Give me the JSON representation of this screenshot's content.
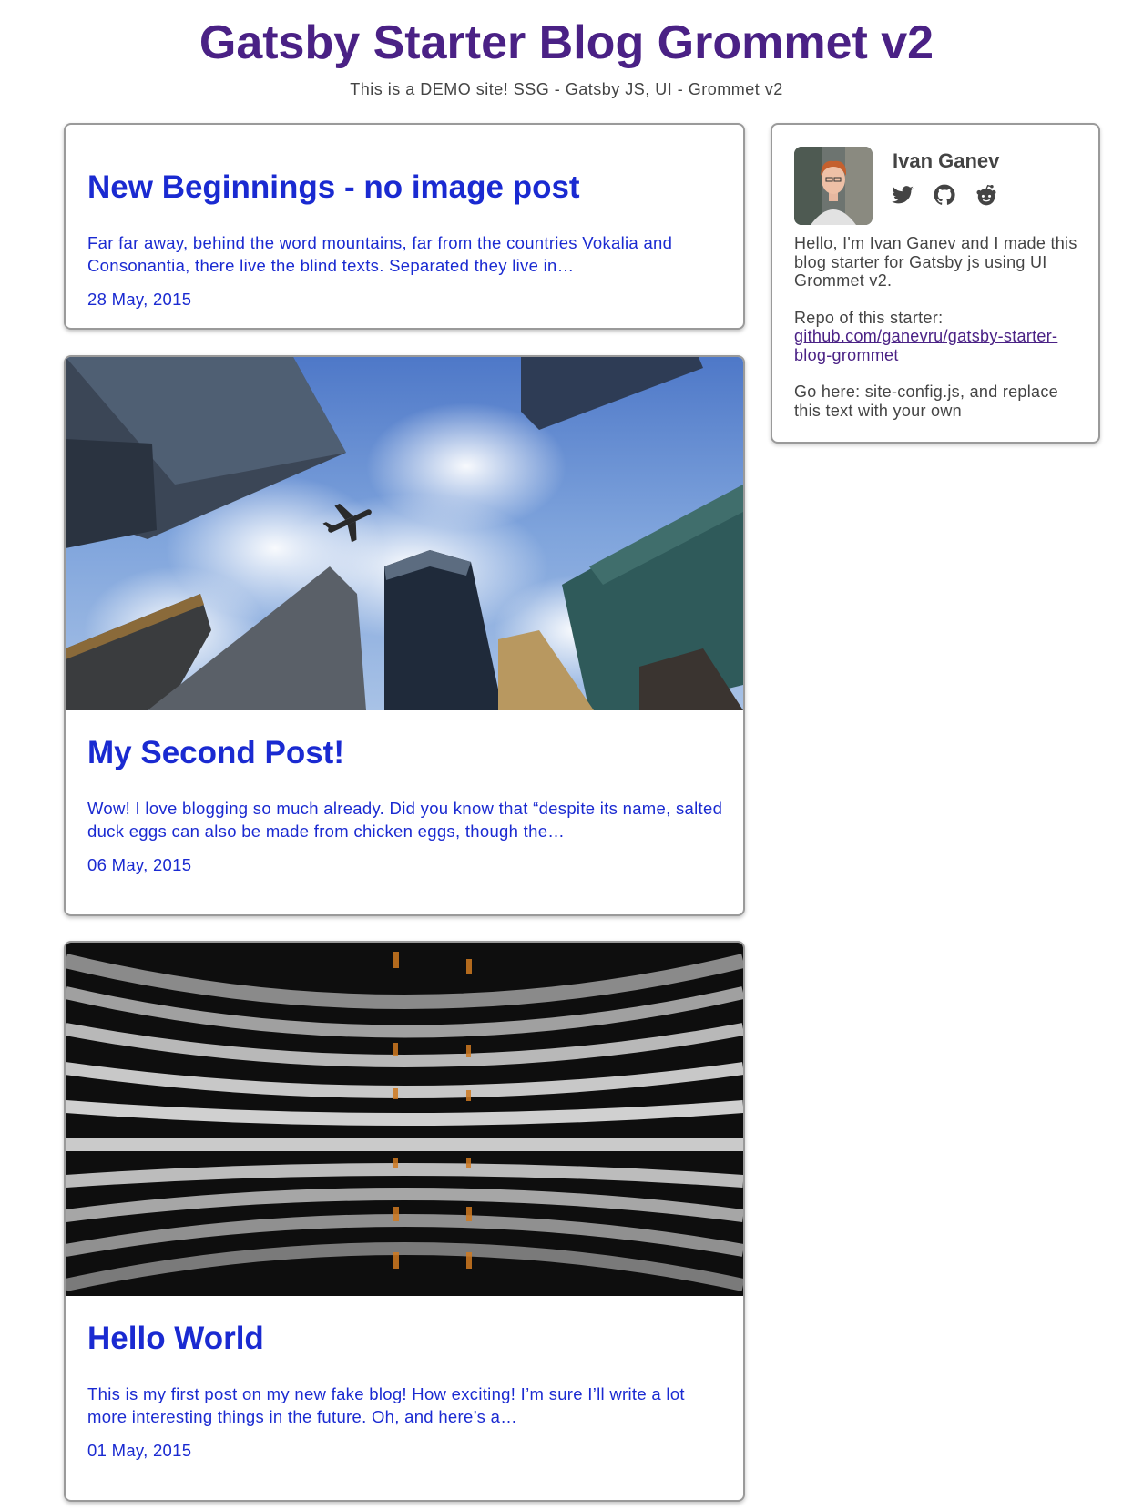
{
  "site": {
    "title": "Gatsby Starter Blog Grommet v2",
    "subtitle": "This is a DEMO site! SSG - Gatsby JS, UI - Grommet v2"
  },
  "posts": [
    {
      "title": "New Beginnings - no image post",
      "excerpt": "Far far away, behind the word mountains, far from the countries Vokalia and Consonantia, there live the blind texts. Separated they live in…",
      "date": "28 May, 2015",
      "image": "none"
    },
    {
      "title": "My Second Post!",
      "excerpt": "Wow! I love blogging so much already. Did you know that “despite its name, salted duck eggs can also be made from chicken eggs, though the…",
      "date": "06 May, 2015",
      "image": "skyscrapers-with-airplane"
    },
    {
      "title": "Hello World",
      "excerpt": "This is my first post on my new fake blog! How exciting! I’m sure I’ll write a lot more interesting things in the future. Oh, and here’s a…",
      "date": "01 May, 2015",
      "image": "curved-building-balconies"
    }
  ],
  "sidebar": {
    "author_name": "Ivan Ganev",
    "social_icons": [
      "twitter-icon",
      "github-icon",
      "reddit-icon"
    ],
    "bio_intro": "Hello, I'm Ivan Ganev and I made this blog starter for Gatsby js using UI Grommet v2.",
    "repo_label": "Repo of this starter:",
    "repo_link": "github.com/ganevru/gatsby-starter-blog-grommet",
    "go_here": "Go here: site-config.js, and replace this text with your own"
  },
  "colors": {
    "brand": "#4a2185",
    "link": "#1a2ad1",
    "text": "#444444",
    "border": "#9a9a9a"
  }
}
